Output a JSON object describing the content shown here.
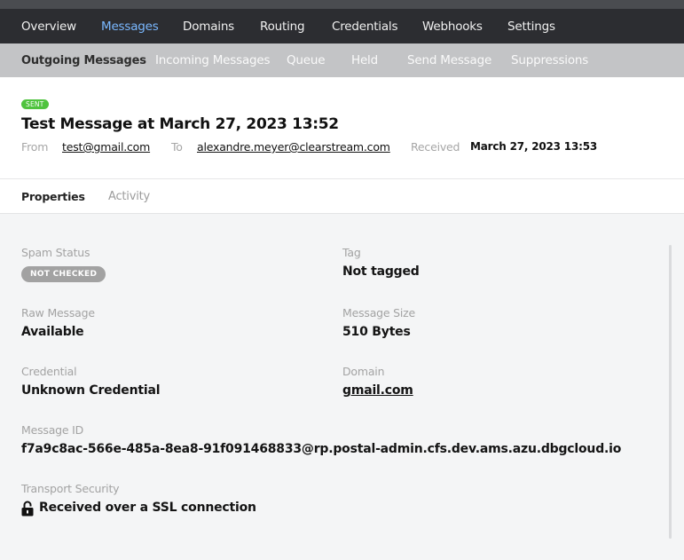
{
  "main_nav": {
    "items": [
      {
        "label": "Overview"
      },
      {
        "label": "Messages"
      },
      {
        "label": "Domains"
      },
      {
        "label": "Routing"
      },
      {
        "label": "Credentials"
      },
      {
        "label": "Webhooks"
      },
      {
        "label": "Settings"
      }
    ],
    "active": "Messages",
    "active_color": "#7ab8ff"
  },
  "sub_nav": {
    "items": [
      {
        "label": "Outgoing Messages"
      },
      {
        "label": "Incoming Messages"
      },
      {
        "label": "Queue"
      },
      {
        "label": "Held"
      },
      {
        "label": "Send Message"
      },
      {
        "label": "Suppressions"
      }
    ],
    "active": "Outgoing Messages"
  },
  "message": {
    "status_badge": "SENT",
    "status_color": "#4fc33e",
    "title": "Test Message at March 27, 2023 13:52",
    "from_label": "From",
    "from": "test@gmail.com",
    "to_label": "To",
    "to": "alexandre.meyer@clearstream.com",
    "received_label": "Received",
    "received": "March 27, 2023 13:53"
  },
  "tabs": {
    "items": [
      {
        "label": "Properties"
      },
      {
        "label": "Activity"
      }
    ],
    "active": "Properties"
  },
  "properties": {
    "spam_status": {
      "label": "Spam Status",
      "value": "NOT CHECKED"
    },
    "tag": {
      "label": "Tag",
      "value": "Not tagged"
    },
    "raw_message": {
      "label": "Raw Message",
      "value": "Available"
    },
    "message_size": {
      "label": "Message Size",
      "value": "510 Bytes"
    },
    "credential": {
      "label": "Credential",
      "value": "Unknown Credential"
    },
    "domain": {
      "label": "Domain",
      "value": "gmail.com"
    },
    "message_id": {
      "label": "Message ID",
      "value": "f7a9c8ac-566e-485a-8ea8-91f091468833@rp.postal-admin.cfs.dev.ams.azu.dbgcloud.io"
    },
    "transport_security": {
      "label": "Transport Security",
      "value": "Received over a SSL connection",
      "icon": "lock-icon"
    }
  }
}
